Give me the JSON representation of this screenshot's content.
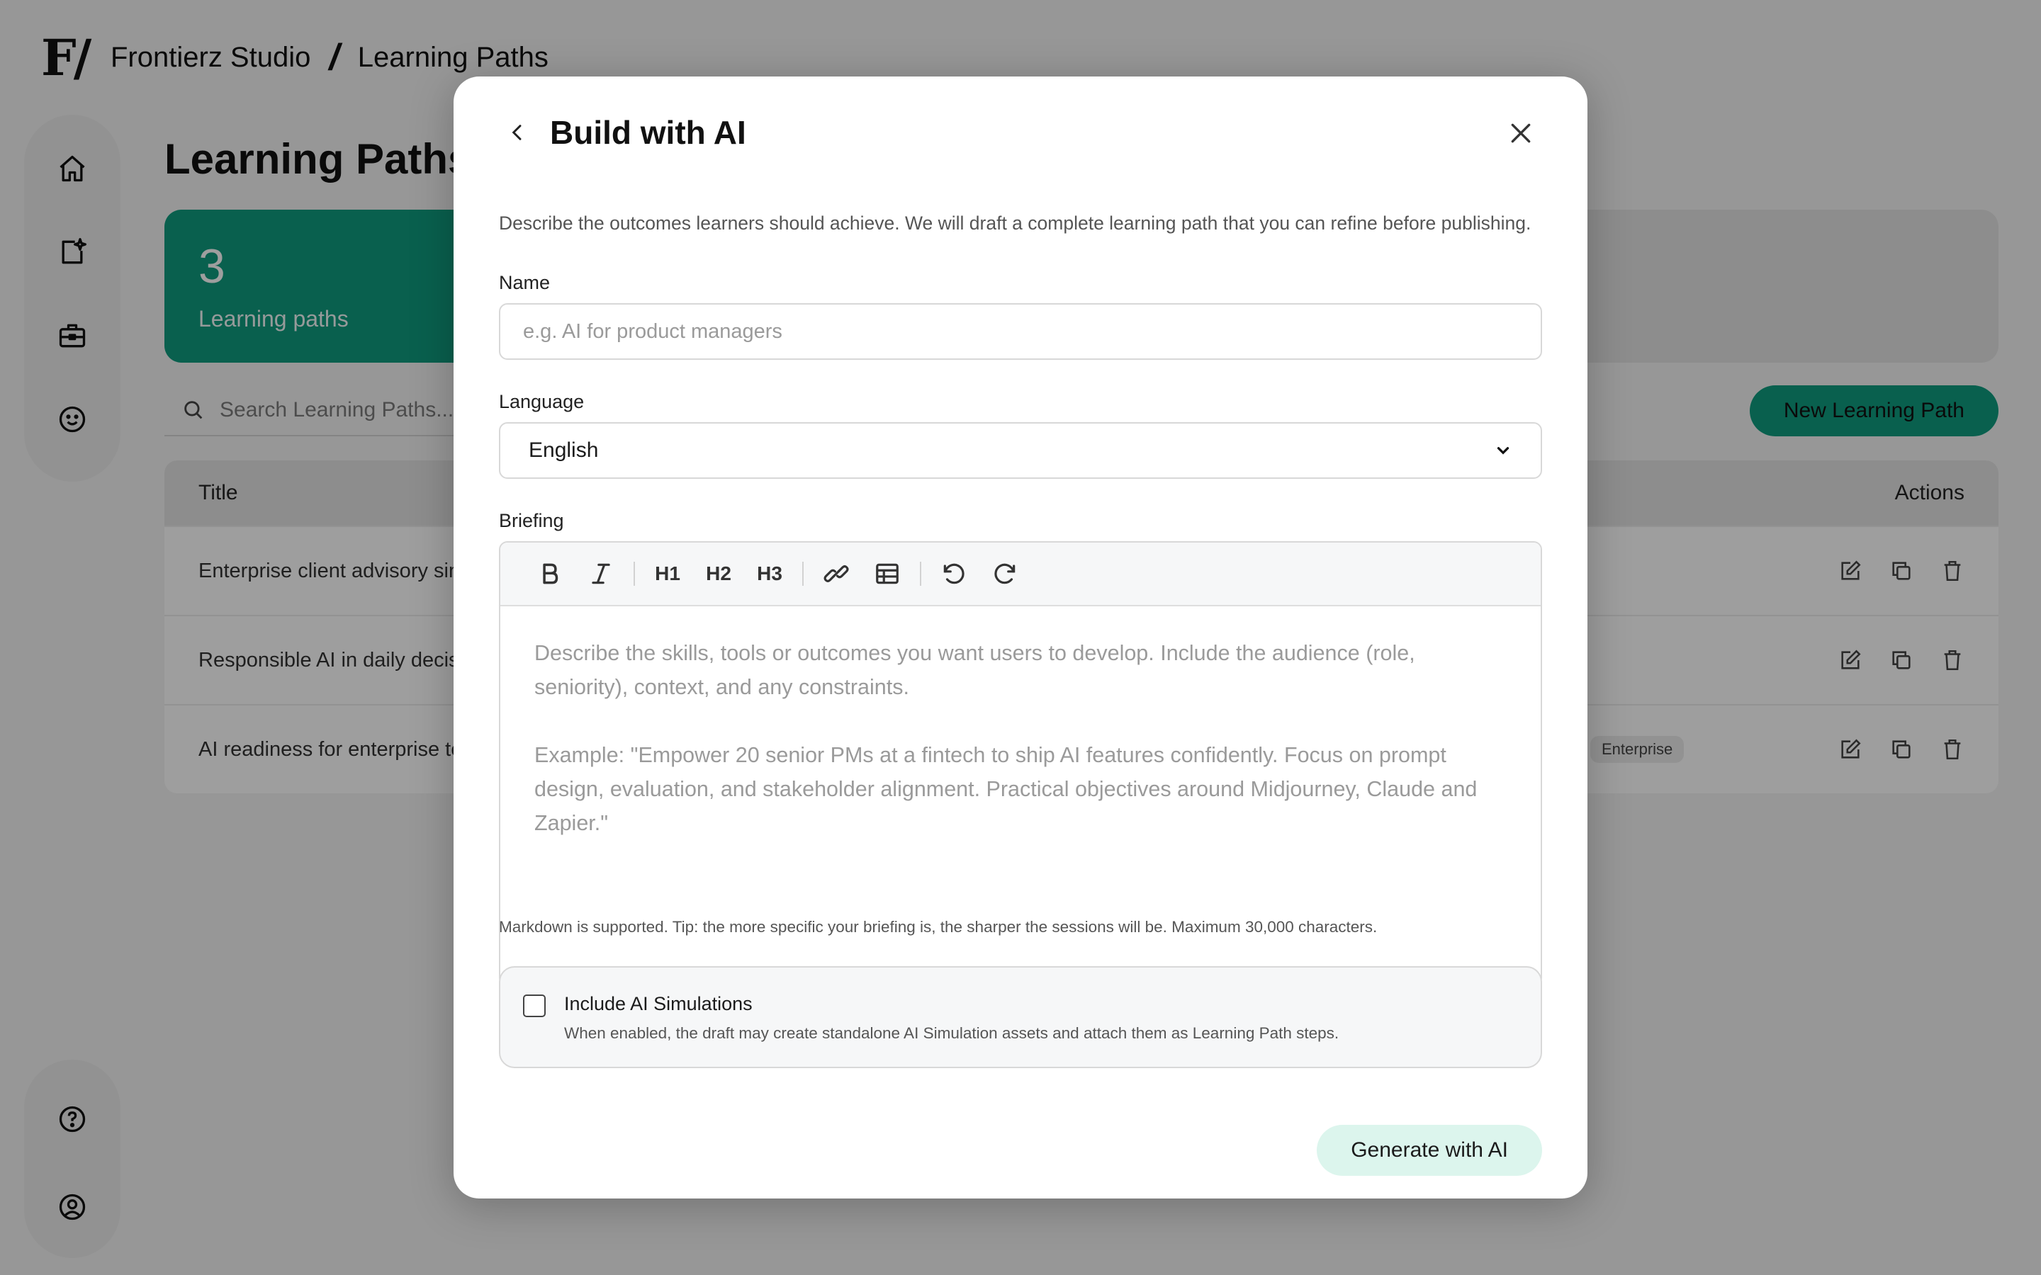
{
  "app": {
    "logo_text": "F/",
    "brand": "Frontierz Studio",
    "crumb_sep": "/",
    "crumb": "Learning Paths"
  },
  "main": {
    "page_title": "Learning Paths",
    "stat": {
      "value": "3",
      "label": "Learning paths"
    },
    "search_placeholder": "Search Learning Paths...",
    "new_button": "New Learning Path",
    "table": {
      "col_title": "Title",
      "col_actions": "Actions",
      "rows": [
        {
          "title": "Enterprise client advisory sin"
        },
        {
          "title": "Responsible AI in daily decisi"
        },
        {
          "title": "AI readiness for enterprise te",
          "tag": "Enterprise"
        }
      ]
    }
  },
  "modal": {
    "title": "Build with AI",
    "description": "Describe the outcomes learners should achieve. We will draft a complete learning path that you can refine before publishing.",
    "name_label": "Name",
    "name_placeholder": "e.g. AI for product managers",
    "name_value": "",
    "language_label": "Language",
    "language_value": "English",
    "briefing_label": "Briefing",
    "toolbar": {
      "h1": "H1",
      "h2": "H2",
      "h3": "H3"
    },
    "briefing_placeholder_1": "Describe the skills, tools or outcomes you want users to develop. Include the audience (role, seniority), context, and any constraints.",
    "briefing_placeholder_2": "Example: \"Empower 20 senior PMs at a fintech to ship AI features confidently. Focus on prompt design, evaluation, and stakeholder alignment. Practical objectives around Midjourney, Claude and Zapier.\"",
    "hint": "Markdown is supported. Tip: the more specific your briefing is, the sharper the sessions will be. Maximum 30,000 characters.",
    "sim_title": "Include AI Simulations",
    "sim_desc": "When enabled, the draft may create standalone AI Simulation assets and attach them as Learning Path steps.",
    "sim_checked": false,
    "generate_button": "Generate with AI"
  },
  "colors": {
    "accent": "#0f9b7e",
    "accent_light": "#dcf5ed",
    "overlay": "rgba(0,0,0,0.38)"
  }
}
